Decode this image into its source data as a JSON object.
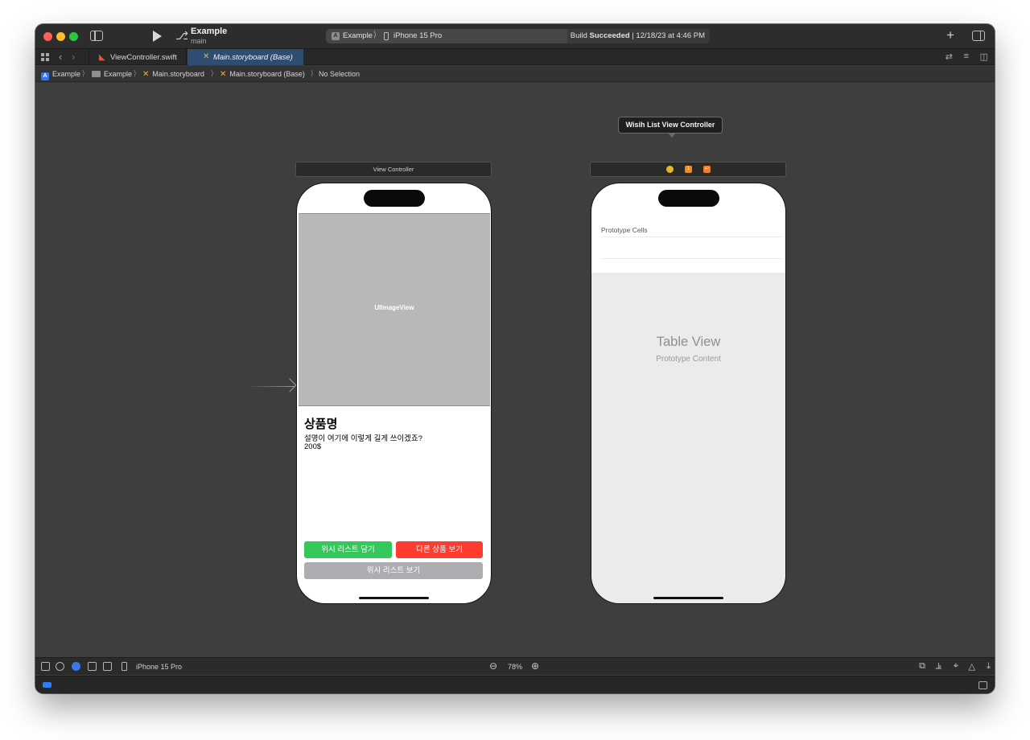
{
  "titlebar": {
    "project_name": "Example",
    "branch": "main",
    "scheme": "Example",
    "device": "iPhone 15 Pro",
    "build_status_prefix": "Build ",
    "build_status_bold": "Succeeded",
    "build_status_suffix": " | 12/18/23 at 4:46 PM"
  },
  "tabs": [
    {
      "label": "ViewController.swift",
      "icon": "swift-file-icon",
      "active": false
    },
    {
      "label": "Main.storyboard (Base)",
      "icon": "storyboard-icon",
      "active": true
    }
  ],
  "breadcrumb": [
    {
      "label": "Example",
      "icon": "app-project-icon"
    },
    {
      "label": "Example",
      "icon": "folder-icon"
    },
    {
      "label": "Main.storyboard",
      "icon": "storyboard-icon"
    },
    {
      "label": "Main.storyboard (Base)",
      "icon": "storyboard-icon"
    },
    {
      "label": "No Selection",
      "icon": ""
    }
  ],
  "scenes": {
    "view_controller": {
      "title": "View Controller",
      "image_view_label": "UIImageView",
      "product_name": "상품명",
      "product_description": "설명이 여기에 이렇게 길게 쓰이겠죠?",
      "product_price": "200$",
      "buttons": {
        "add_wishlist": "위시 리스트 담기",
        "other_product": "다른 상품 보기",
        "view_wishlist": "위시 리스트 보기"
      }
    },
    "wishlist_view_controller": {
      "tooltip": "Wisih List View Controller",
      "prototype_cells_header": "Prototype Cells",
      "table_view_title": "Table View",
      "table_view_subtitle": "Prototype Content"
    }
  },
  "bottom_toolbar": {
    "device": "iPhone 15 Pro",
    "zoom": "78%"
  },
  "colors": {
    "accent_tab": "#2f4d73",
    "green_button": "#34c759",
    "red_button": "#ff3b30",
    "gray_button": "#aeaeb2"
  }
}
